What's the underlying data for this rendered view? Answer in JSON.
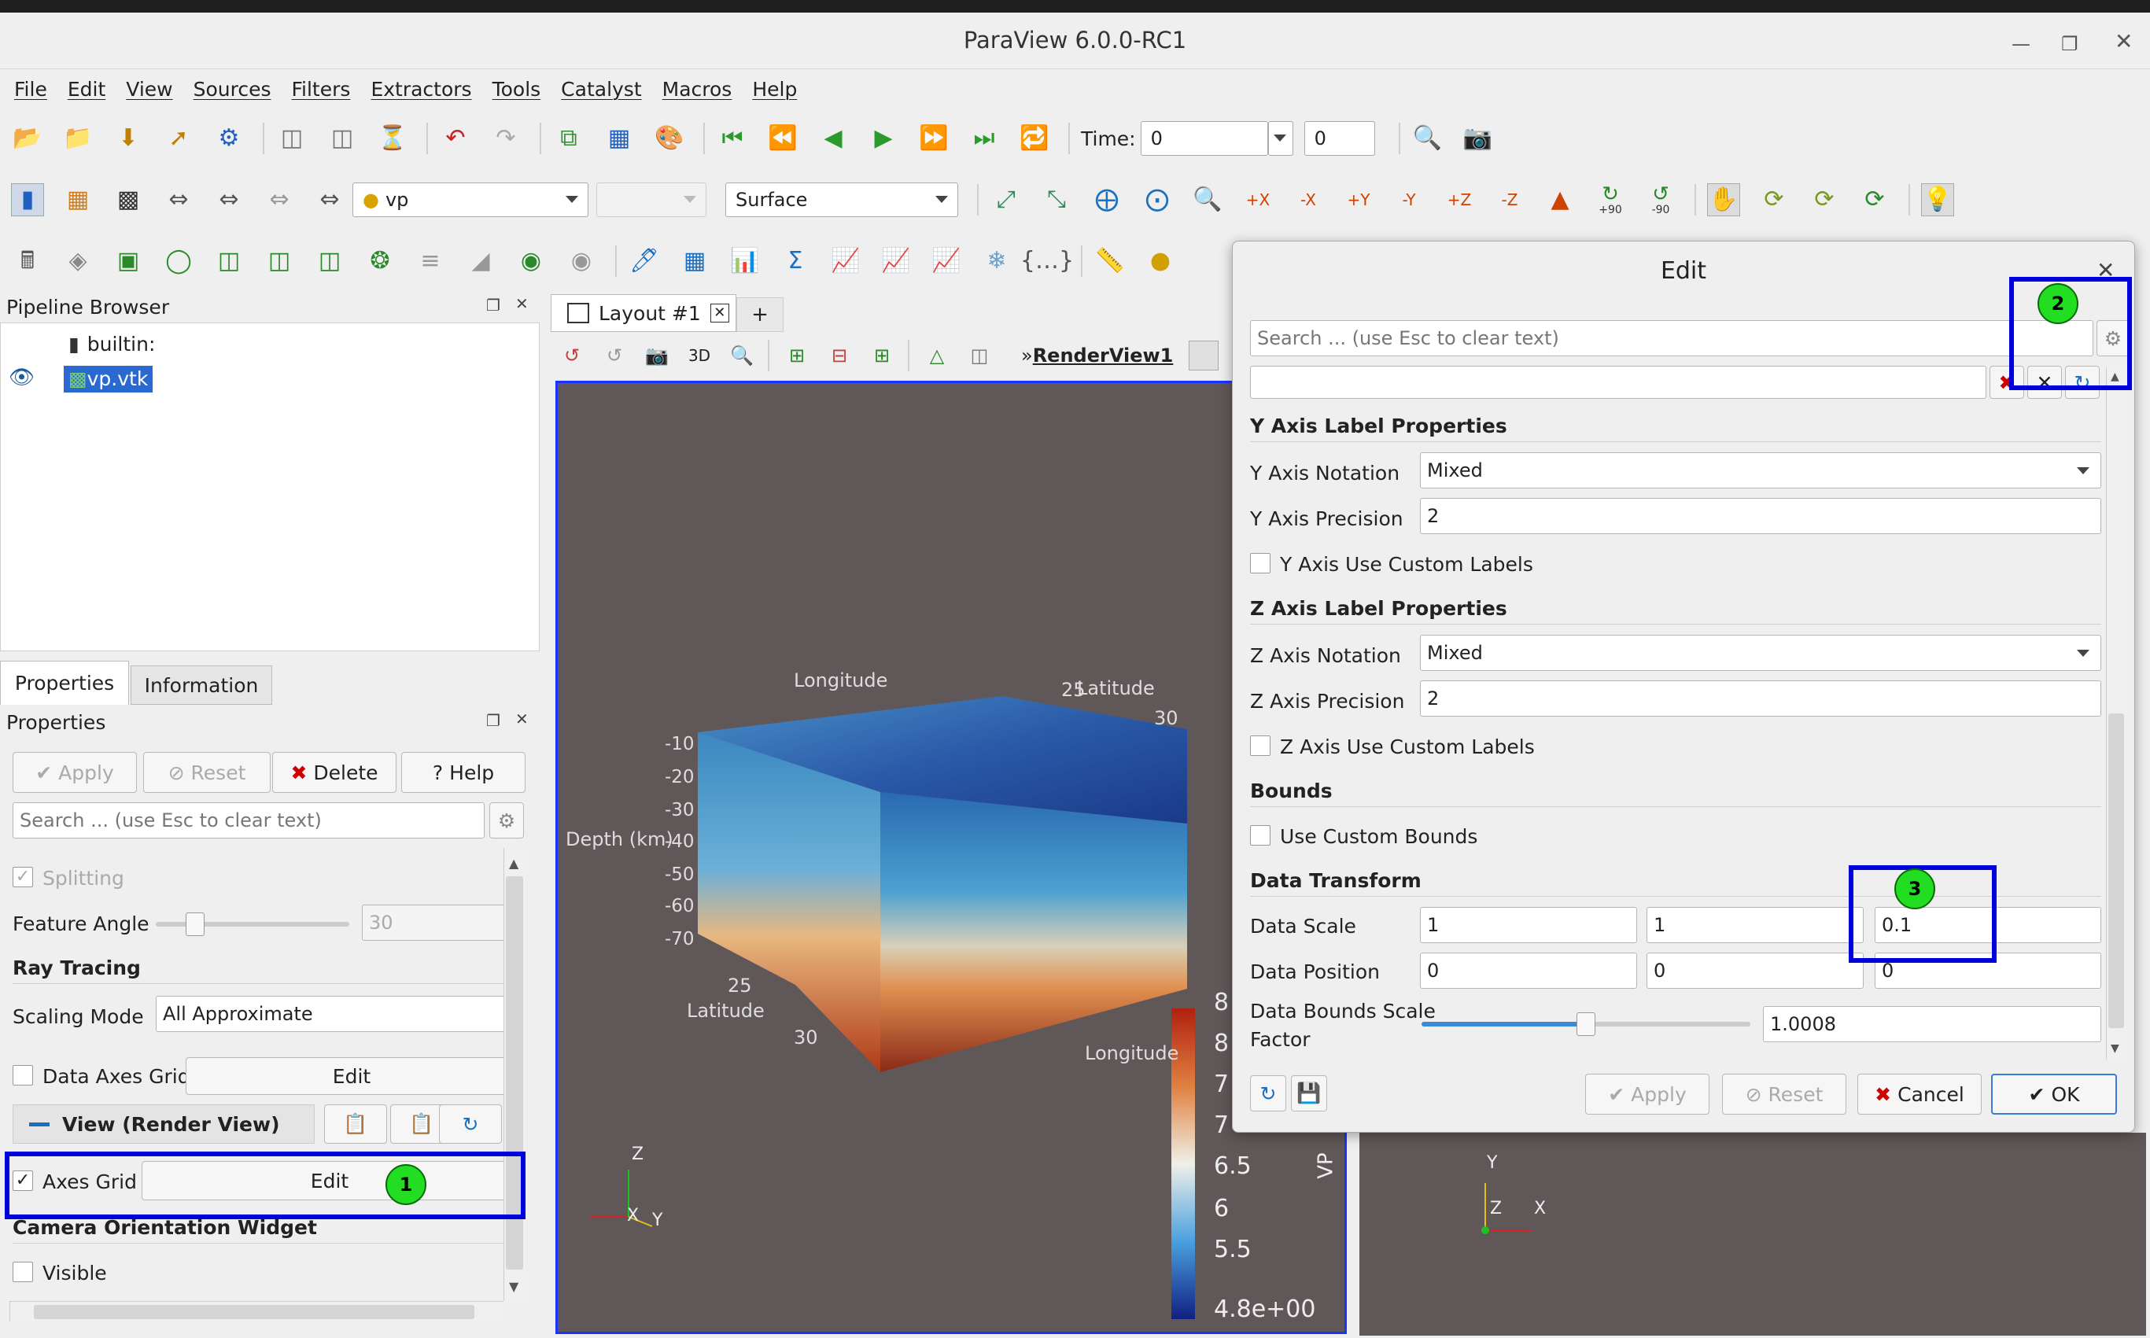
{
  "app": {
    "title": "ParaView 6.0.0-RC1"
  },
  "menu": [
    "File",
    "Edit",
    "View",
    "Sources",
    "Filters",
    "Extractors",
    "Tools",
    "Catalyst",
    "Macros",
    "Help"
  ],
  "toolbar": {
    "time_label": "Time:",
    "time_value": "0",
    "timestep_value": "0",
    "source_combo": "vp",
    "representation": "Surface",
    "rot_plus": "+90",
    "rot_minus": "-90"
  },
  "pipeline": {
    "title": "Pipeline Browser",
    "root": "builtin:",
    "item": "vp.vtk"
  },
  "tabs": {
    "properties": "Properties",
    "information": "Information"
  },
  "props": {
    "title": "Properties",
    "apply": "Apply",
    "reset": "Reset",
    "delete": "Delete",
    "help": "Help",
    "search_placeholder": "Search ... (use Esc to clear text)",
    "splitting": "Splitting",
    "feature_angle": "Feature Angle",
    "feature_angle_value": "30",
    "ray_tracing": "Ray Tracing",
    "scaling_mode": "Scaling Mode",
    "scaling_mode_value": "All Approximate",
    "data_axes_grid": "Data Axes Grid",
    "edit": "Edit",
    "view_section": "View (Render View)",
    "axes_grid": "Axes Grid",
    "camera_widget": "Camera Orientation Widget",
    "visible": "Visible"
  },
  "layout": {
    "tab": "Layout #1",
    "add": "+",
    "view_3d": "3D",
    "render_view": "RenderView1"
  },
  "scene": {
    "longitude": "Longitude",
    "latitude": "Latitude",
    "depth": "Depth (km)",
    "depth_ticks": [
      "-10",
      "-20",
      "-30",
      "-40",
      "-50",
      "-60",
      "-70"
    ],
    "lat_ticks_left": [
      "25",
      "30"
    ],
    "lat_ticks_top": [
      "25",
      "30"
    ],
    "colorbar_title": "VP",
    "colorbar_ticks": [
      "8",
      "8",
      "7",
      "7",
      "6.5",
      "6",
      "5.5",
      "4.8e+00"
    ],
    "axis_x": "X",
    "axis_y": "Y",
    "axis_z": "Z"
  },
  "dialog": {
    "title": "Edit",
    "search_placeholder": "Search ... (use Esc to clear text)",
    "y_section": "Y Axis Label Properties",
    "y_notation": "Y Axis Notation",
    "y_notation_value": "Mixed",
    "y_precision": "Y Axis Precision",
    "y_precision_value": "2",
    "y_custom": "Y Axis Use Custom Labels",
    "z_section": "Z Axis Label Properties",
    "z_notation": "Z Axis Notation",
    "z_notation_value": "Mixed",
    "z_precision": "Z Axis Precision",
    "z_precision_value": "2",
    "z_custom": "Z Axis Use Custom Labels",
    "bounds_section": "Bounds",
    "custom_bounds": "Use Custom Bounds",
    "transform_section": "Data Transform",
    "data_scale": "Data Scale",
    "data_scale_values": [
      "1",
      "1",
      "0.1"
    ],
    "data_position": "Data Position",
    "data_position_values": [
      "0",
      "0",
      "0"
    ],
    "bounds_scale_1": "Data Bounds Scale",
    "bounds_scale_2": "Factor",
    "bounds_scale_value": "1.0008",
    "bounds_scale_level": 0.5,
    "apply": "Apply",
    "reset": "Reset",
    "cancel": "Cancel",
    "ok": "OK"
  },
  "annotations": [
    "1",
    "2",
    "3"
  ],
  "colors": {
    "highlight": "#0000dd",
    "badge": "#22dd22",
    "delete_red": "#d00000"
  }
}
